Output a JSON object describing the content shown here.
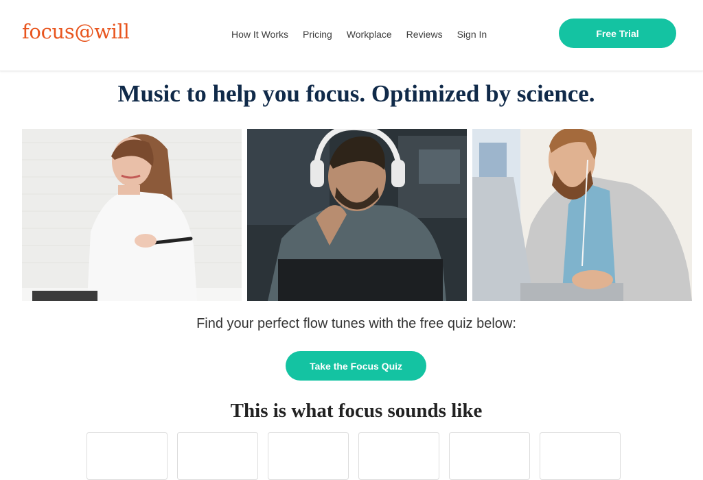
{
  "header": {
    "logo_text": "focus@will",
    "nav": [
      "How It Works",
      "Pricing",
      "Workplace",
      "Reviews",
      "Sign In"
    ],
    "cta_label": "Free Trial"
  },
  "hero": {
    "title": "Music to help you focus. Optimized by science.",
    "photos": [
      {
        "icon": "woman-smiling-photo"
      },
      {
        "icon": "man-headphones-photo"
      },
      {
        "icon": "man-laptop-earbuds-photo"
      }
    ]
  },
  "quiz": {
    "text": "Find your perfect flow tunes with the free quiz below:",
    "button_label": "Take the Focus Quiz"
  },
  "sounds": {
    "title": "This is what focus sounds like",
    "card_count": 6
  },
  "colors": {
    "brand_orange": "#e8551e",
    "accent_teal": "#14c3a2",
    "navy": "#102a49"
  }
}
